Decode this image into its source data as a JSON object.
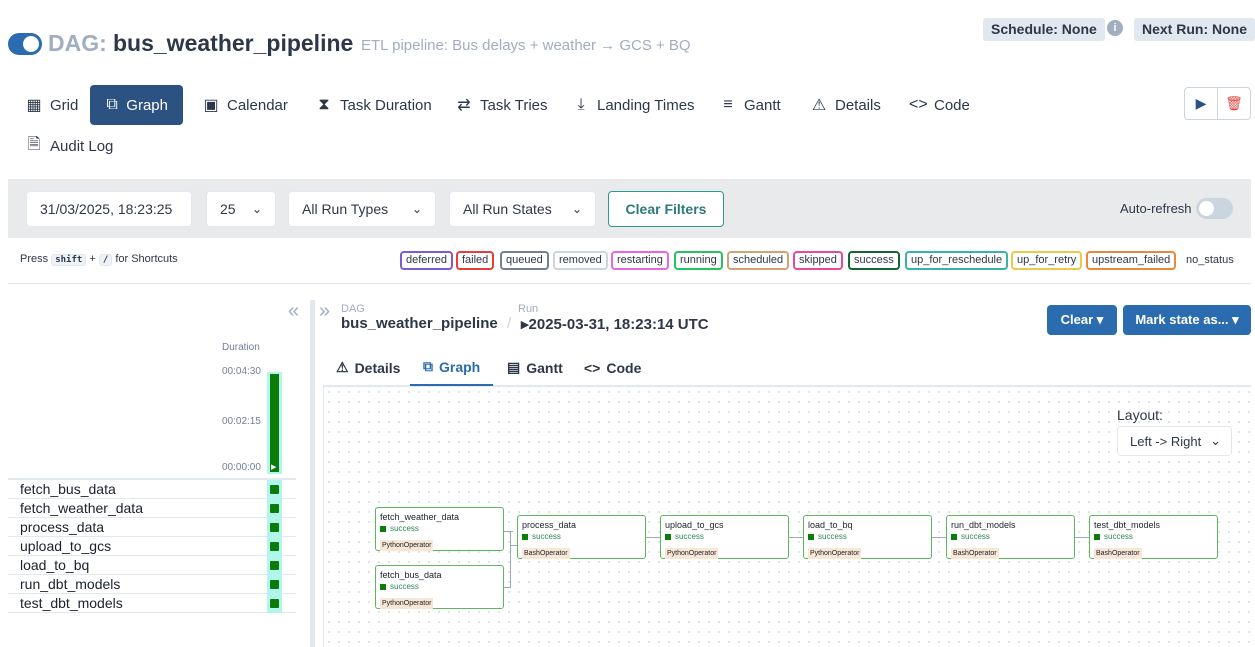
{
  "header": {
    "dag_prefix": "DAG:",
    "dag_id": "bus_weather_pipeline",
    "description": "ETL pipeline: Bus delays + weather → GCS + BQ",
    "schedule": "Schedule: None",
    "next_run": "Next Run: None",
    "info_icon": "i"
  },
  "nav_tabs": [
    {
      "label": "Grid",
      "icon": "grid-icon"
    },
    {
      "label": "Graph",
      "icon": "graph-icon",
      "active": true
    },
    {
      "label": "Calendar",
      "icon": "calendar-icon"
    },
    {
      "label": "Task Duration",
      "icon": "hourglass-icon"
    },
    {
      "label": "Task Tries",
      "icon": "retry-icon"
    },
    {
      "label": "Landing Times",
      "icon": "plane-landing-icon"
    },
    {
      "label": "Gantt",
      "icon": "gantt-icon"
    },
    {
      "label": "Details",
      "icon": "warning-triangle-icon"
    },
    {
      "label": "Code",
      "icon": "code-icon"
    },
    {
      "label": "Audit Log",
      "icon": "document-search-icon"
    }
  ],
  "filters": {
    "execution_date": "31/03/2025, 18:23:25",
    "num_runs": "25",
    "run_types": "All Run Types",
    "run_states": "All Run States",
    "clear_filters": "Clear Filters",
    "auto_refresh": "Auto-refresh"
  },
  "shortcuts": {
    "press": "Press",
    "key1": "shift",
    "plus": "+",
    "key2": "/",
    "suffix": "for Shortcuts"
  },
  "legend": [
    {
      "label": "deferred",
      "color": "#805ad5"
    },
    {
      "label": "failed",
      "color": "#e53e3e"
    },
    {
      "label": "queued",
      "color": "#718096"
    },
    {
      "label": "removed",
      "color": "#cbd5e0"
    },
    {
      "label": "restarting",
      "color": "#ed64e0"
    },
    {
      "label": "running",
      "color": "#22c55e"
    },
    {
      "label": "scheduled",
      "color": "#d4a373"
    },
    {
      "label": "skipped",
      "color": "#ec4899"
    },
    {
      "label": "success",
      "color": "#166534"
    },
    {
      "label": "up_for_reschedule",
      "color": "#38b2ac"
    },
    {
      "label": "up_for_retry",
      "color": "#ecc94b"
    },
    {
      "label": "upstream_failed",
      "color": "#ed8936"
    },
    {
      "label": "no_status",
      "color": ""
    }
  ],
  "grid": {
    "collapse_icon": "«",
    "duration_label": "Duration",
    "ticks": [
      "00:04:30",
      "00:02:15",
      "00:00:00"
    ],
    "tasks": [
      "fetch_bus_data",
      "fetch_weather_data",
      "process_data",
      "upload_to_gcs",
      "load_to_bq",
      "run_dbt_models",
      "test_dbt_models"
    ]
  },
  "details": {
    "expand_icon": "»",
    "dag_label": "DAG",
    "dag_value": "bus_weather_pipeline",
    "sep": "/",
    "run_label": "Run",
    "run_value": "▸2025-03-31, 18:23:14 UTC",
    "clear_btn": "Clear ▾",
    "mark_btn": "Mark state as... ▾",
    "tabs": [
      {
        "label": "Details",
        "icon": "warning-triangle-icon"
      },
      {
        "label": "Graph",
        "icon": "graph-icon",
        "active": true
      },
      {
        "label": "Gantt",
        "icon": "gantt-icon"
      },
      {
        "label": "Code",
        "icon": "code-icon"
      }
    ]
  },
  "graph": {
    "layout_label": "Layout:",
    "layout_value": "Left -> Right",
    "nodes": [
      {
        "id": "fetch_weather_data",
        "state": "success",
        "operator": "PythonOperator"
      },
      {
        "id": "fetch_bus_data",
        "state": "success",
        "operator": "PythonOperator"
      },
      {
        "id": "process_data",
        "state": "success",
        "operator": "BashOperator"
      },
      {
        "id": "upload_to_gcs",
        "state": "success",
        "operator": "PythonOperator"
      },
      {
        "id": "load_to_bq",
        "state": "success",
        "operator": "PythonOperator"
      },
      {
        "id": "run_dbt_models",
        "state": "success",
        "operator": "BashOperator"
      },
      {
        "id": "test_dbt_models",
        "state": "success",
        "operator": "BashOperator"
      }
    ]
  }
}
